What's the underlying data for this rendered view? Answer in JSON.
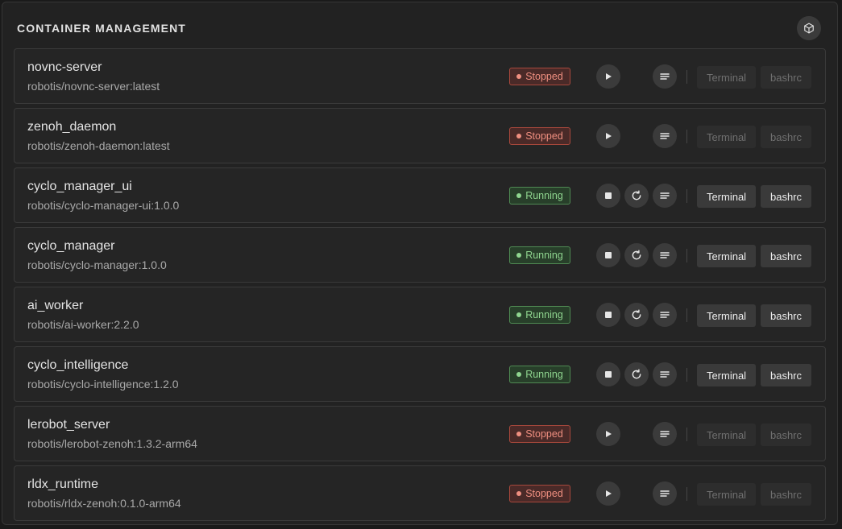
{
  "header": {
    "title": "CONTAINER MANAGEMENT",
    "icon": "cube-icon"
  },
  "status_colors": {
    "Stopped": "#ef8f80",
    "Running": "#8fd58f"
  },
  "actions": {
    "terminal_label": "Terminal",
    "bashrc_label": "bashrc"
  },
  "containers": [
    {
      "name": "novnc-server",
      "image": "robotis/novnc-server:latest",
      "status": "Stopped"
    },
    {
      "name": "zenoh_daemon",
      "image": "robotis/zenoh-daemon:latest",
      "status": "Stopped"
    },
    {
      "name": "cyclo_manager_ui",
      "image": "robotis/cyclo-manager-ui:1.0.0",
      "status": "Running"
    },
    {
      "name": "cyclo_manager",
      "image": "robotis/cyclo-manager:1.0.0",
      "status": "Running"
    },
    {
      "name": "ai_worker",
      "image": "robotis/ai-worker:2.2.0",
      "status": "Running"
    },
    {
      "name": "cyclo_intelligence",
      "image": "robotis/cyclo-intelligence:1.2.0",
      "status": "Running"
    },
    {
      "name": "lerobot_server",
      "image": "robotis/lerobot-zenoh:1.3.2-arm64",
      "status": "Stopped"
    },
    {
      "name": "rldx_runtime",
      "image": "robotis/rldx-zenoh:0.1.0-arm64",
      "status": "Stopped"
    }
  ]
}
